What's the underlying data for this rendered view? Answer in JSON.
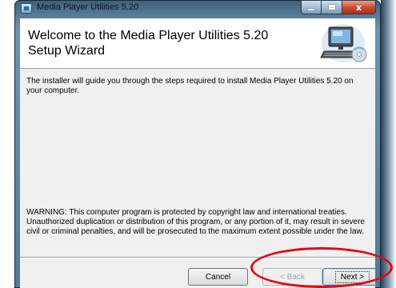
{
  "window": {
    "title": "Media Player Utilities 5.20",
    "caption_close": "x"
  },
  "banner": {
    "title": "Welcome to the Media Player Utilities 5.20 Setup Wizard",
    "graphic_icon": "computer-setup-icon"
  },
  "body": {
    "intro": "The installer will guide you through the steps required to install Media Player Utilities 5.20 on your computer.",
    "warning": "WARNING: This computer program is protected by copyright law and international treaties. Unauthorized duplication or distribution of this program, or any portion of it, may result in severe civil or criminal penalties, and will be prosecuted to the maximum extent possible under the law."
  },
  "buttons": {
    "cancel": "Cancel",
    "back": "< Back",
    "next": "Next >"
  },
  "annotation": {
    "color": "#e30613"
  }
}
